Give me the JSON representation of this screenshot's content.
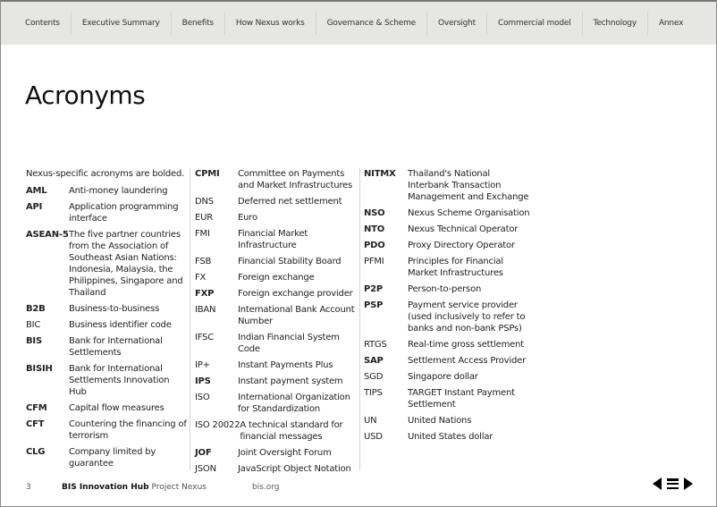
{
  "nav": [
    "Contents",
    "Executive Summary",
    "Benefits",
    "How Nexus works",
    "Governance & Scheme",
    "Oversight",
    "Commercial model",
    "Technology",
    "Annex"
  ],
  "title": "Acronyms",
  "intro": "Nexus-specific acronyms are bolded.",
  "columns": [
    [
      {
        "term": "AML",
        "def": "Anti-money laundering",
        "bold": true
      },
      {
        "term": "API",
        "def": "Application programming interface",
        "bold": true
      },
      {
        "term": "ASEAN-5",
        "def": "The five partner countries from the Association of Southeast Asian Nations: Indonesia, Malaysia, the Philippines, Singapore and Thailand",
        "bold": true
      },
      {
        "term": "B2B",
        "def": "Business-to-business",
        "bold": true
      },
      {
        "term": "BIC",
        "def": "Business identifier code",
        "bold": false
      },
      {
        "term": "BIS",
        "def": "Bank for International Settlements",
        "bold": true
      },
      {
        "term": "BISIH",
        "def": "Bank for International Settlements Innovation Hub",
        "bold": true
      },
      {
        "term": "CFM",
        "def": "Capital flow measures",
        "bold": true
      },
      {
        "term": "CFT",
        "def": "Countering the financing of terrorism",
        "bold": true
      },
      {
        "term": "CLG",
        "def": "Company limited by guarantee",
        "bold": true
      }
    ],
    [
      {
        "term": "CPMI",
        "def": "Committee on Payments and Market Infrastructures",
        "bold": true
      },
      {
        "term": "DNS",
        "def": "Deferred net settlement",
        "bold": false
      },
      {
        "term": "EUR",
        "def": "Euro",
        "bold": false
      },
      {
        "term": "FMI",
        "def": "Financial Market Infrastructure",
        "bold": false
      },
      {
        "term": "FSB",
        "def": "Financial Stability Board",
        "bold": false
      },
      {
        "term": "FX",
        "def": "Foreign exchange",
        "bold": false
      },
      {
        "term": "FXP",
        "def": "Foreign exchange provider",
        "bold": true
      },
      {
        "term": "IBAN",
        "def": "International Bank Account Number",
        "bold": false
      },
      {
        "term": "IFSC",
        "def": "Indian Financial System Code",
        "bold": false
      },
      {
        "term": "IP+",
        "def": "Instant Payments Plus",
        "bold": false
      },
      {
        "term": "IPS",
        "def": "Instant payment system",
        "bold": true
      },
      {
        "term": "ISO",
        "def": "International Organization for Standardization",
        "bold": false
      },
      {
        "term": "ISO 20022",
        "def": "A technical standard for financial messages",
        "bold": false
      },
      {
        "term": "JOF",
        "def": "Joint Oversight Forum",
        "bold": true
      },
      {
        "term": "JSON",
        "def": "JavaScript Object Notation",
        "bold": false
      }
    ],
    [
      {
        "term": "NITMX",
        "def": "Thailand's National Interbank Transaction Management and Exchange",
        "bold": true
      },
      {
        "term": "NSO",
        "def": "Nexus Scheme Organisation",
        "bold": true
      },
      {
        "term": "NTO",
        "def": "Nexus Technical Operator",
        "bold": true
      },
      {
        "term": "PDO",
        "def": "Proxy Directory Operator",
        "bold": true
      },
      {
        "term": "PFMI",
        "def": "Principles for Financial Market Infrastructures",
        "bold": false
      },
      {
        "term": "P2P",
        "def": "Person-to-person",
        "bold": true
      },
      {
        "term": "PSP",
        "def": "Payment service provider (used inclusively to refer to banks and non-bank PSPs)",
        "bold": true
      },
      {
        "term": "RTGS",
        "def": "Real-time gross settlement",
        "bold": false
      },
      {
        "term": "SAP",
        "def": "Settlement Access Provider",
        "bold": true
      },
      {
        "term": "SGD",
        "def": "Singapore dollar",
        "bold": false
      },
      {
        "term": "TIPS",
        "def": "TARGET Instant Payment Settlement",
        "bold": false
      },
      {
        "term": "UN",
        "def": "United Nations",
        "bold": false
      },
      {
        "term": "USD",
        "def": "United States dollar",
        "bold": false
      }
    ]
  ],
  "footer": {
    "page": "3",
    "brand": "BIS Innovation Hub",
    "project": "Project Nexus",
    "site": "bis.org"
  },
  "icons": {
    "prev": "triangle-left-icon",
    "menu": "menu-icon",
    "next": "triangle-right-icon"
  }
}
